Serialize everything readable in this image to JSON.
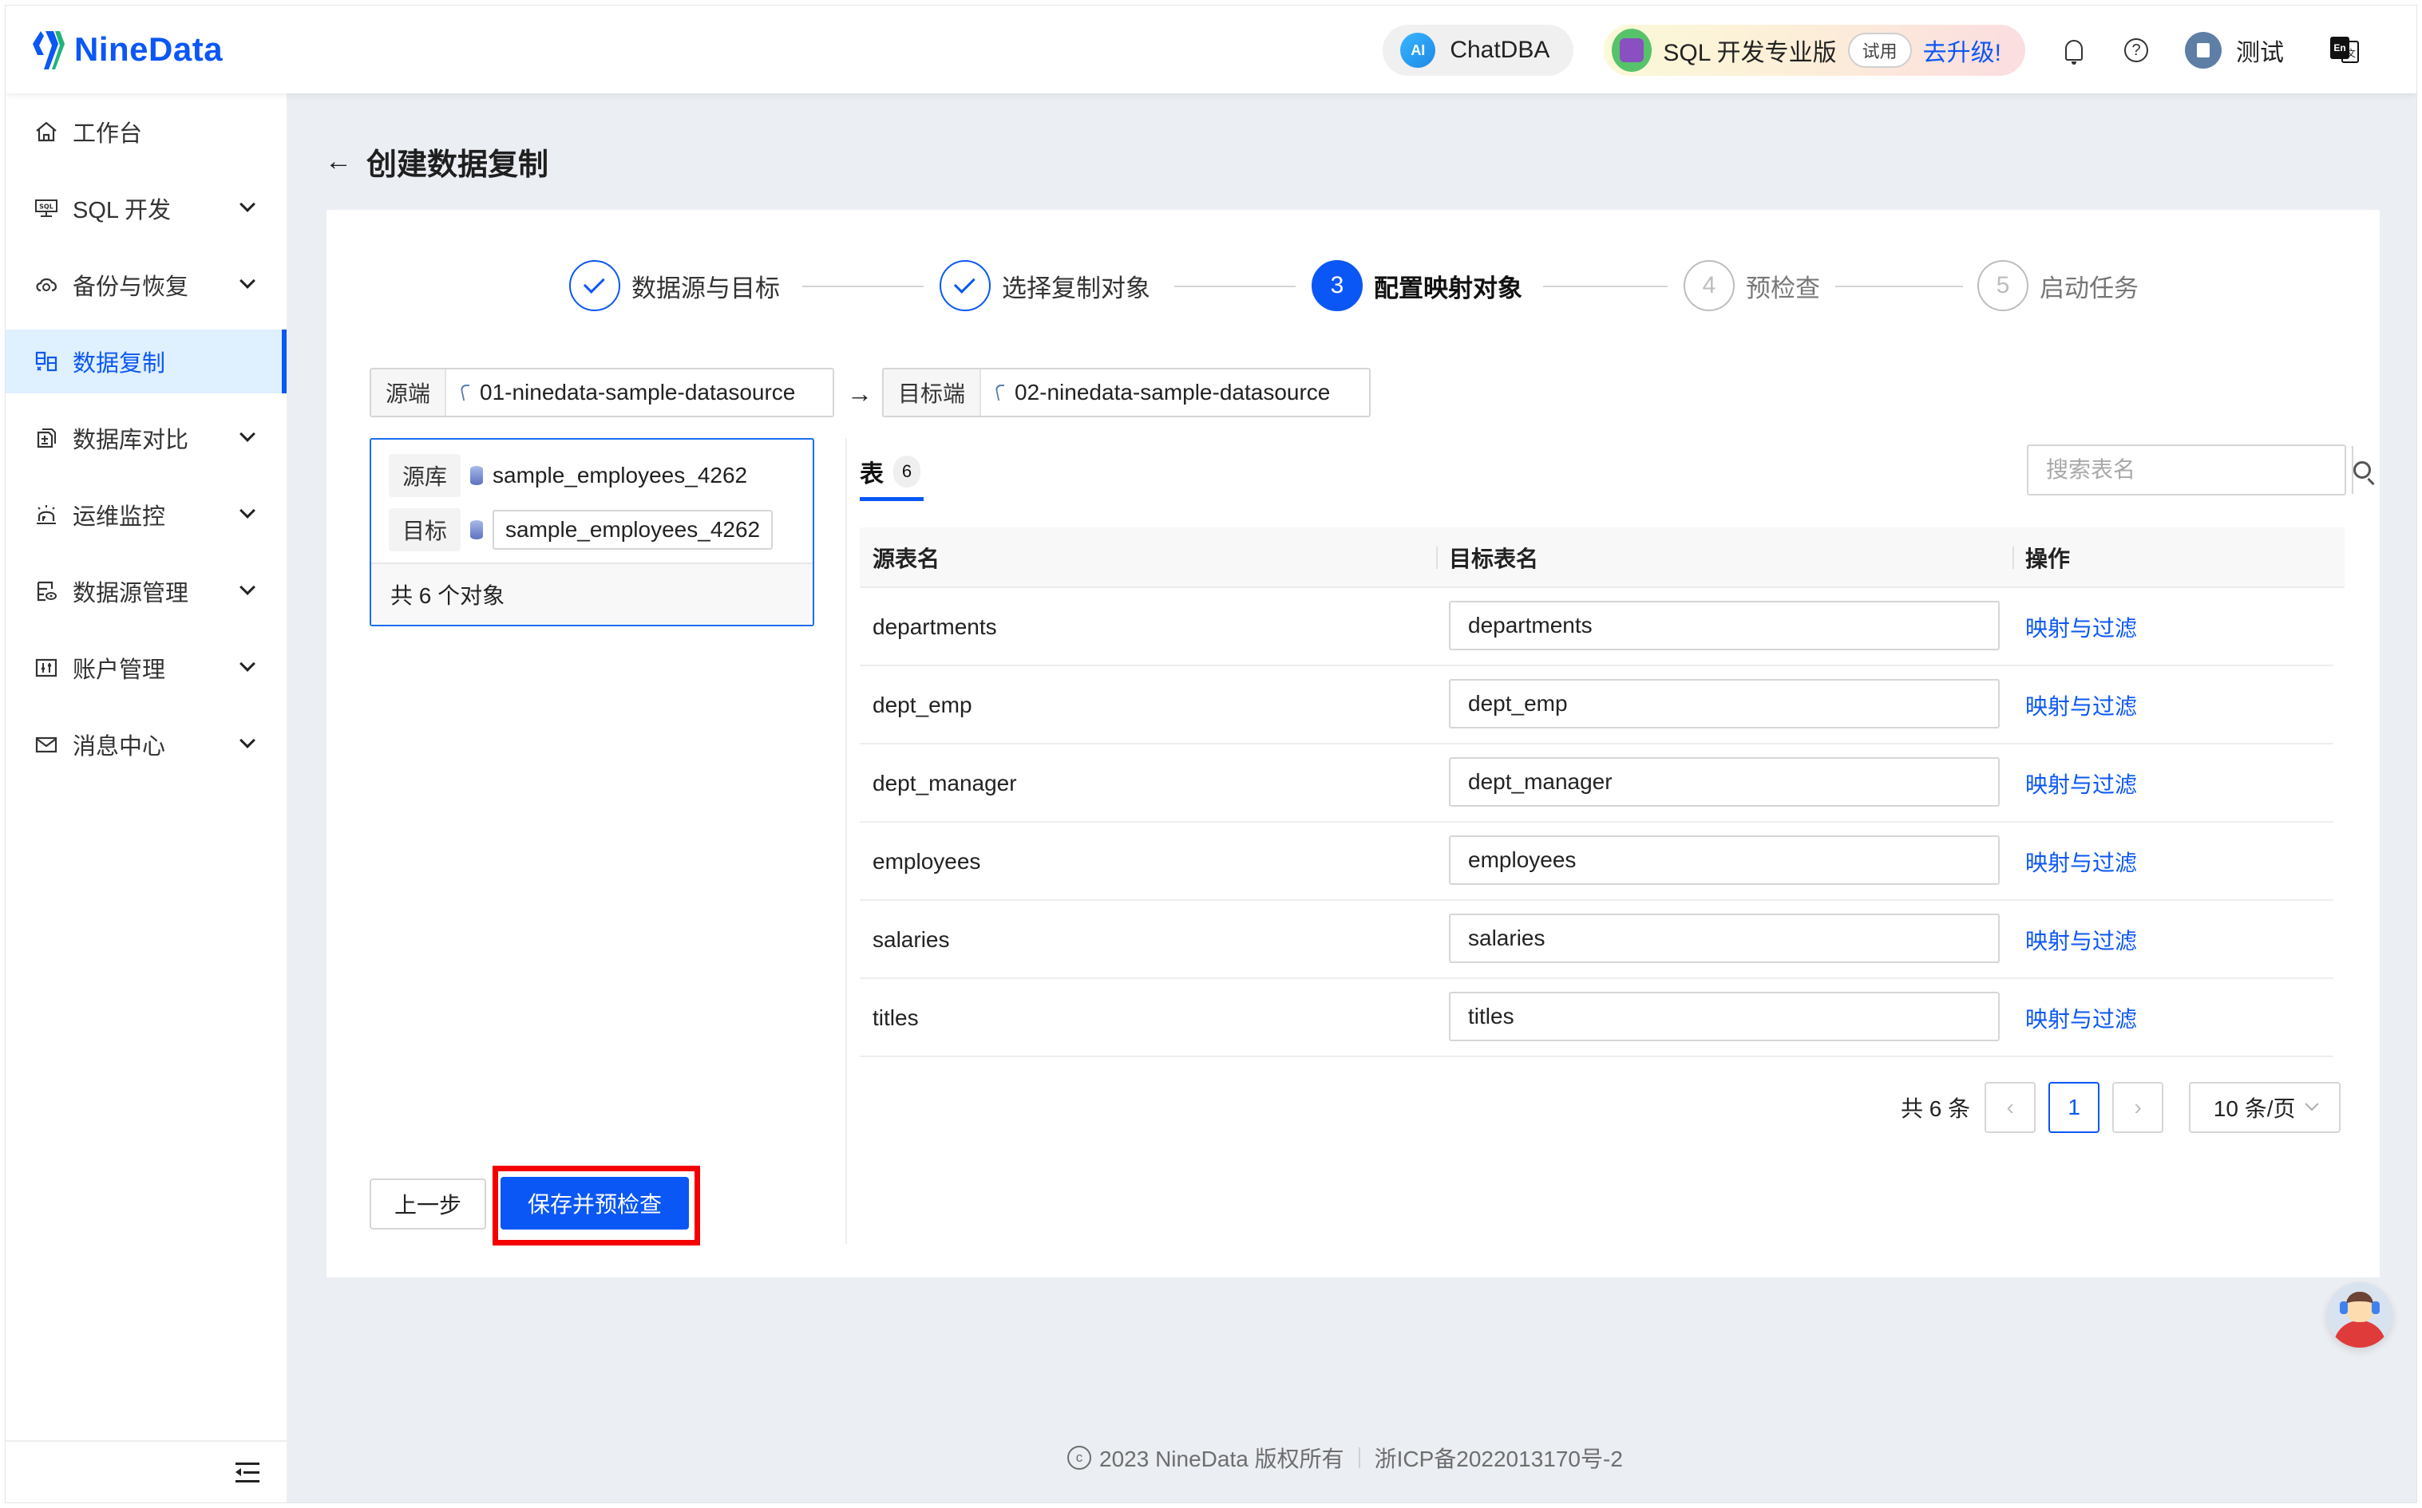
{
  "app": {
    "brand": "NineData"
  },
  "header": {
    "chatdba_label": "ChatDBA",
    "chatdba_badge": "AI",
    "edition_label": "SQL 开发专业版",
    "trial_badge": "试用",
    "upgrade_link": "去升级!",
    "username": "测试",
    "lang_en": "En",
    "lang_zh": "文"
  },
  "sidebar": {
    "items": [
      {
        "label": "工作台",
        "icon": "home-icon",
        "expandable": false,
        "active": false
      },
      {
        "label": "SQL 开发",
        "icon": "sql-monitor-icon",
        "expandable": true,
        "active": false
      },
      {
        "label": "备份与恢复",
        "icon": "cloud-sync-icon",
        "expandable": true,
        "active": false
      },
      {
        "label": "数据复制",
        "icon": "replication-icon",
        "expandable": false,
        "active": true
      },
      {
        "label": "数据库对比",
        "icon": "compare-icon",
        "expandable": true,
        "active": false
      },
      {
        "label": "运维监控",
        "icon": "alarm-icon",
        "expandable": true,
        "active": false
      },
      {
        "label": "数据源管理",
        "icon": "datasource-icon",
        "expandable": true,
        "active": false
      },
      {
        "label": "账户管理",
        "icon": "account-icon",
        "expandable": true,
        "active": false
      },
      {
        "label": "消息中心",
        "icon": "mail-icon",
        "expandable": true,
        "active": false
      }
    ]
  },
  "page": {
    "title": "创建数据复制",
    "back_icon": "arrow-left-icon"
  },
  "steps": [
    {
      "index": "1",
      "label": "数据源与目标",
      "status": "done"
    },
    {
      "index": "2",
      "label": "选择复制对象",
      "status": "done"
    },
    {
      "index": "3",
      "label": "配置映射对象",
      "status": "current"
    },
    {
      "index": "4",
      "label": "预检查",
      "status": "todo"
    },
    {
      "index": "5",
      "label": "启动任务",
      "status": "todo"
    }
  ],
  "endpoints": {
    "source_tag": "源端",
    "source_name": "01-ninedata-sample-datasource",
    "target_tag": "目标端",
    "target_name": "02-ninedata-sample-datasource"
  },
  "object_panel": {
    "source_db_tag": "源库",
    "source_db": "sample_employees_4262",
    "target_db_tag": "目标",
    "target_db": "sample_employees_4262",
    "summary": "共 6 个对象"
  },
  "tabs": [
    {
      "label": "表",
      "count": "6",
      "active": true
    }
  ],
  "search": {
    "placeholder": "搜索表名",
    "value": ""
  },
  "table": {
    "columns": [
      "源表名",
      "目标表名",
      "操作"
    ],
    "rows": [
      {
        "source": "departments",
        "target": "departments",
        "action": "映射与过滤"
      },
      {
        "source": "dept_emp",
        "target": "dept_emp",
        "action": "映射与过滤"
      },
      {
        "source": "dept_manager",
        "target": "dept_manager",
        "action": "映射与过滤"
      },
      {
        "source": "employees",
        "target": "employees",
        "action": "映射与过滤"
      },
      {
        "source": "salaries",
        "target": "salaries",
        "action": "映射与过滤"
      },
      {
        "source": "titles",
        "target": "titles",
        "action": "映射与过滤"
      }
    ]
  },
  "pagination": {
    "total_label": "共 6 条",
    "current_page": "1",
    "page_size": "10 条/页"
  },
  "actions": {
    "prev_label": "上一步",
    "save_label": "保存并预检查"
  },
  "footer": {
    "copyright": "2023 NineData 版权所有",
    "icp": "浙ICP备2022013170号-2"
  },
  "colors": {
    "primary": "#0B57F5",
    "highlight_box": "#F50000",
    "active_nav_bg": "#DFF0FE",
    "page_bg": "#EBEEF3"
  }
}
